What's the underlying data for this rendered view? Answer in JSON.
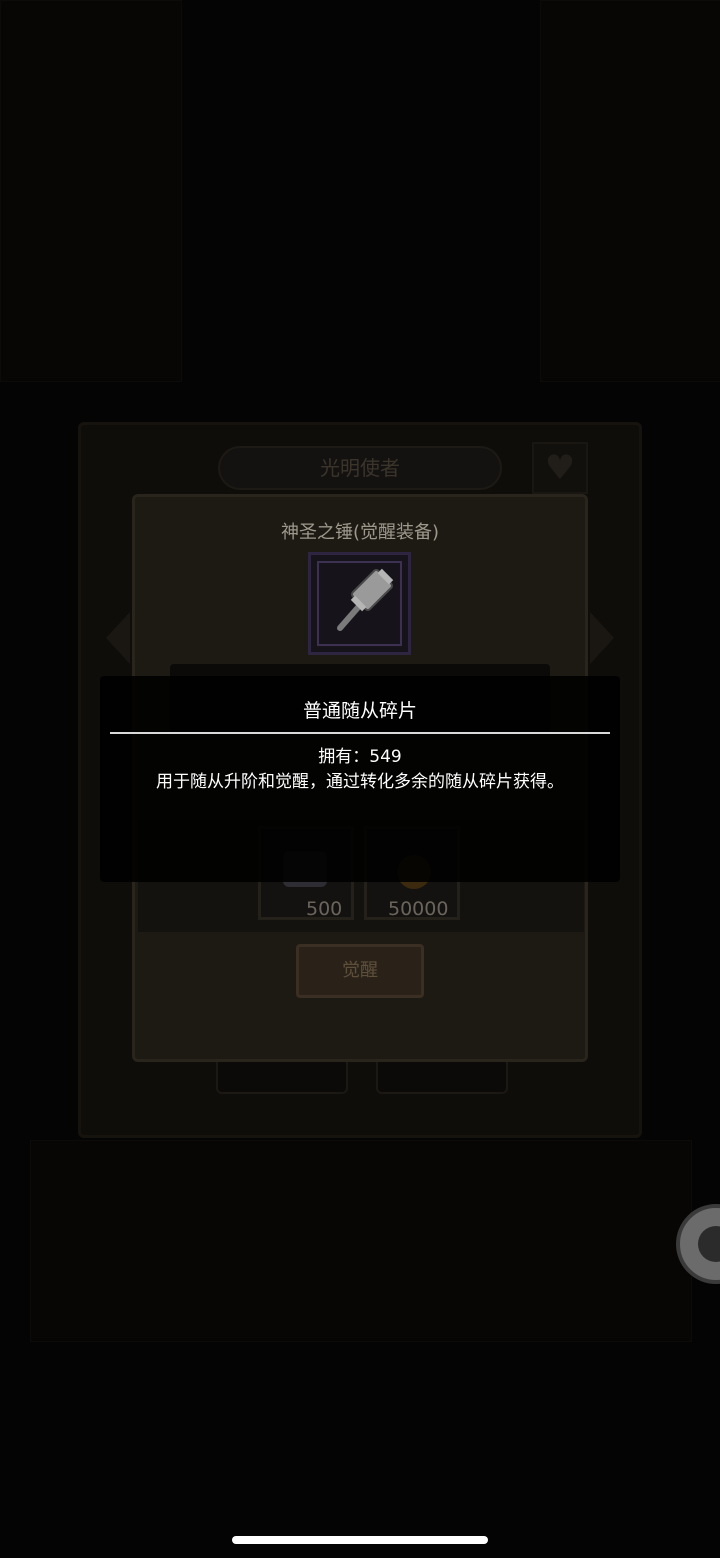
{
  "outer_panel": {
    "title": "光明使者"
  },
  "item_panel": {
    "title": "神圣之锤(觉醒装备)",
    "item_icon": "hammer-icon",
    "costs": [
      {
        "icon": "fragment-icon",
        "amount": "500"
      },
      {
        "icon": "gold-coin-icon",
        "amount": "50000"
      }
    ],
    "awaken_label": "觉醒"
  },
  "tooltip": {
    "title": "普通随从碎片",
    "owned": "拥有：549",
    "description": "用于随从升阶和觉醒，通过转化多余的随从碎片获得。"
  },
  "colors": {
    "tooltip_bg": "#000000",
    "parchment": "#1d1a14",
    "slot_frame": "#2e2540"
  }
}
